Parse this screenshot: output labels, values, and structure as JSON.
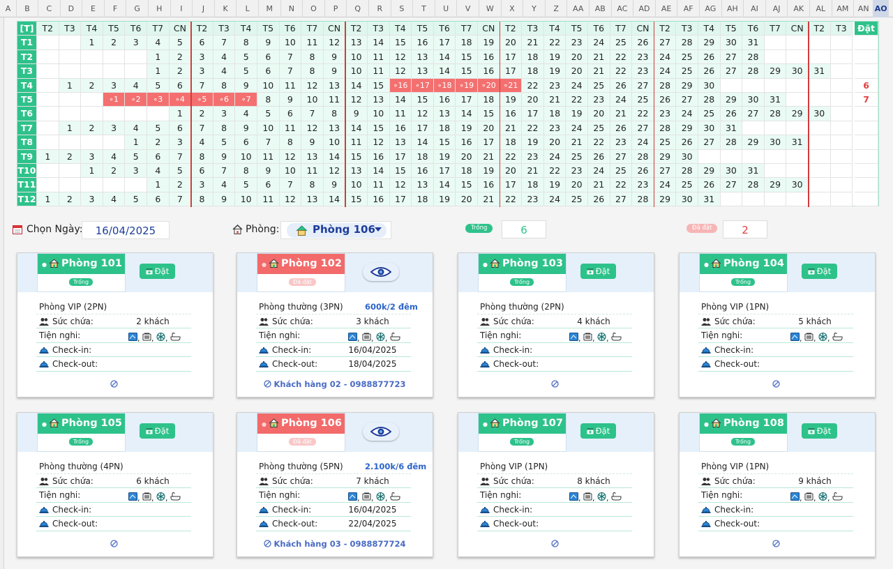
{
  "sheet": {
    "columns": [
      "A",
      "B",
      "C",
      "D",
      "E",
      "F",
      "G",
      "H",
      "I",
      "J",
      "K",
      "L",
      "M",
      "N",
      "O",
      "P",
      "Q",
      "R",
      "S",
      "T",
      "U",
      "V",
      "W",
      "X",
      "Y",
      "Z",
      "AA",
      "AB",
      "AC",
      "AD",
      "AE",
      "AF",
      "AG",
      "AH",
      "AI",
      "AJ",
      "AK",
      "AL",
      "AM",
      "AN",
      "AO"
    ],
    "selected_column": "AO"
  },
  "calendar": {
    "corner": "[T]",
    "weekday_headers": [
      "T2",
      "T3",
      "T4",
      "T5",
      "T6",
      "T7",
      "CN",
      "T2",
      "T3",
      "T4",
      "T5",
      "T6",
      "T7",
      "CN",
      "T2",
      "T3",
      "T4",
      "T5",
      "T6",
      "T7",
      "CN",
      "T2",
      "T3",
      "T4",
      "T5",
      "T6",
      "T7",
      "CN",
      "T2",
      "T3",
      "T4",
      "T5",
      "T6",
      "T7",
      "CN",
      "T2",
      "T3"
    ],
    "count_header": "Đặt",
    "months": [
      {
        "label": "T1",
        "start": 2,
        "days": 31,
        "count": ""
      },
      {
        "label": "T2",
        "start": 5,
        "days": 28,
        "count": ""
      },
      {
        "label": "T3",
        "start": 5,
        "days": 31,
        "count": ""
      },
      {
        "label": "T4",
        "start": 1,
        "days": 30,
        "count": "6",
        "booked_from": 16,
        "booked_to": 21
      },
      {
        "label": "T5",
        "start": 3,
        "days": 31,
        "count": "7",
        "booked_from": 1,
        "booked_to": 7
      },
      {
        "label": "T6",
        "start": 6,
        "days": 30,
        "count": ""
      },
      {
        "label": "T7",
        "start": 1,
        "days": 31,
        "count": ""
      },
      {
        "label": "T8",
        "start": 4,
        "days": 31,
        "count": ""
      },
      {
        "label": "T9",
        "start": 0,
        "days": 30,
        "count": ""
      },
      {
        "label": "T10",
        "start": 2,
        "days": 31,
        "count": ""
      },
      {
        "label": "T11",
        "start": 5,
        "days": 30,
        "count": ""
      },
      {
        "label": "T12",
        "start": 0,
        "days": 31,
        "count": ""
      }
    ]
  },
  "toolbar": {
    "date_label": "Chọn Ngày:",
    "date_value": "16/04/2025",
    "room_label": "Phòng:",
    "room_value": "Phòng 106",
    "free_chip": "Trống",
    "free_count": "6",
    "booked_chip": "Đã đặt",
    "booked_count": "2"
  },
  "labels": {
    "capacity": "Sức chứa:",
    "amenities": "Tiện nghi:",
    "checkin": "Check-in:",
    "checkout": "Check-out:",
    "book": "Đặt"
  },
  "colors": {
    "free": "#2ec28b",
    "booked": "#f26a6a",
    "accent": "#2d64c9"
  },
  "rooms": [
    {
      "name": "Phòng 101",
      "status": "Trống",
      "booked": false,
      "type": "Phòng VIP (2PN)",
      "price": "",
      "capacity": "2 khách",
      "checkin": "",
      "checkout": "",
      "customer": ""
    },
    {
      "name": "Phòng 102",
      "status": "Đã đặt",
      "booked": true,
      "type": "Phòng thường (3PN)",
      "price": "600k/2 đêm",
      "capacity": "3 khách",
      "checkin": "16/04/2025",
      "checkout": "18/04/2025",
      "customer": "Khách hàng 02 - 0988877723"
    },
    {
      "name": "Phòng 103",
      "status": "Trống",
      "booked": false,
      "type": "Phòng thường (2PN)",
      "price": "",
      "capacity": "4 khách",
      "checkin": "",
      "checkout": "",
      "customer": ""
    },
    {
      "name": "Phòng 104",
      "status": "Trống",
      "booked": false,
      "type": "Phòng VIP (1PN)",
      "price": "",
      "capacity": "5 khách",
      "checkin": "",
      "checkout": "",
      "customer": ""
    },
    {
      "name": "Phòng 105",
      "status": "Trống",
      "booked": false,
      "type": "Phòng thường (4PN)",
      "price": "",
      "capacity": "6 khách",
      "checkin": "",
      "checkout": "",
      "customer": ""
    },
    {
      "name": "Phòng 106",
      "status": "Đã đặt",
      "booked": true,
      "type": "Phòng thường (5PN)",
      "price": "2.100k/6 đêm",
      "capacity": "7 khách",
      "checkin": "16/04/2025",
      "checkout": "22/04/2025",
      "customer": "Khách hàng 03 - 0988877724"
    },
    {
      "name": "Phòng 107",
      "status": "Trống",
      "booked": false,
      "type": "Phòng VIP (1PN)",
      "price": "",
      "capacity": "8 khách",
      "checkin": "",
      "checkout": "",
      "customer": ""
    },
    {
      "name": "Phòng 108",
      "status": "Trống",
      "booked": false,
      "type": "Phòng VIP (1PN)",
      "price": "",
      "capacity": "9 khách",
      "checkin": "",
      "checkout": "",
      "customer": ""
    }
  ]
}
